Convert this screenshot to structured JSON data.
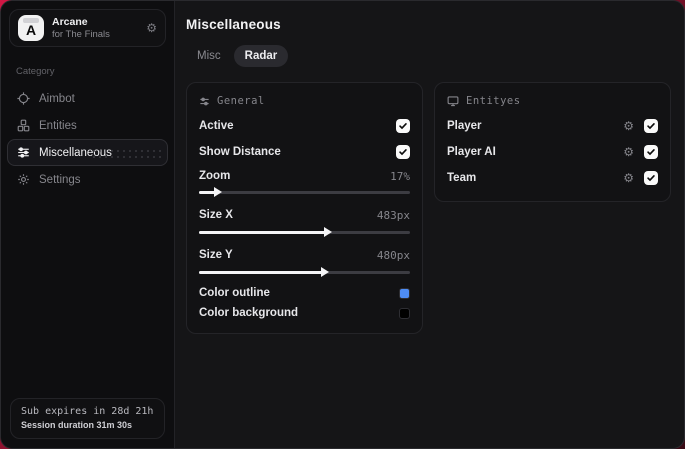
{
  "sidebar": {
    "app": {
      "logo_letter": "A",
      "name": "Arcane",
      "subtitle": "for The Finals"
    },
    "category_label": "Category",
    "items": [
      {
        "label": "Aimbot"
      },
      {
        "label": "Entities"
      },
      {
        "label": "Miscellaneous"
      },
      {
        "label": "Settings"
      }
    ],
    "status": {
      "line1": "Sub expires in 28d 21h",
      "line2": "Session duration 31m 30s"
    }
  },
  "main": {
    "title": "Miscellaneous",
    "tabs": [
      {
        "label": "Misc"
      },
      {
        "label": "Radar"
      }
    ],
    "general_panel": {
      "title": "General",
      "active": {
        "label": "Active",
        "checked": true
      },
      "show_distance": {
        "label": "Show Distance",
        "checked": true
      },
      "zoom": {
        "label": "Zoom",
        "value": "17%",
        "fill_pct": "8%"
      },
      "size_x": {
        "label": "Size X",
        "value": "483px",
        "fill_pct": "60%"
      },
      "size_y": {
        "label": "Size Y",
        "value": "480px",
        "fill_pct": "59%"
      },
      "color_outline": {
        "label": "Color outline",
        "color": "#4e8df6"
      },
      "color_background": {
        "label": "Color background",
        "color": "#000000"
      }
    },
    "entities_panel": {
      "title": "Entityes",
      "rows": [
        {
          "label": "Player",
          "checked": true
        },
        {
          "label": "Player AI",
          "checked": true
        },
        {
          "label": "Team",
          "checked": true
        }
      ]
    }
  }
}
